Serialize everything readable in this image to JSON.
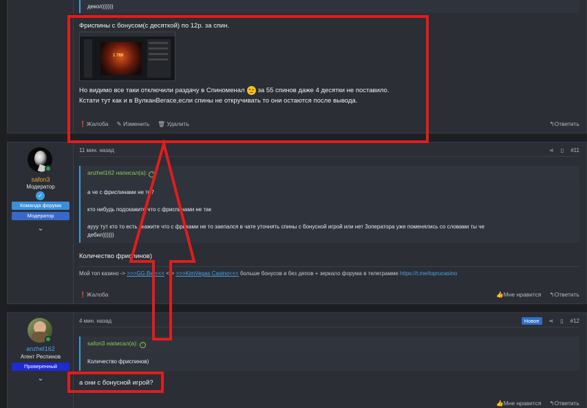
{
  "post10": {
    "top_quote_tail": "декол))))))",
    "line1": "Фриспины с бонусом(с десяткой) по 12р. за спин.",
    "line2_a": "Но видимо все таки отключили раздачу в Спиноменал",
    "line2_b": "за 55 спинов даже 4 десятки не поставило.",
    "line3": "Кстати тут как и в ВулканВегасе,если спины не откручивать то они остаются после вывода.",
    "report": "Жалоба",
    "edit": "Изменить",
    "delete": "Удалить",
    "reply": "Ответить",
    "thumb_title": "1 769"
  },
  "post11": {
    "username": "safon3",
    "user_title": "Модератор",
    "banner1": "Команда форума",
    "banner2": "Модератор",
    "date": "11 мин. назад",
    "number": "#11",
    "quote_author": "anzhel162 написал(а):",
    "quote_lines": [
      "а че с фриспинами не то?",
      "кто нибудь подскажите что с фриспинами не так",
      "аууу тут кто то есть скажите что с фрихами не то заепался в чате уточнять спины с бонусной игрой или нет 3опeратора уже поменялись со словами ты че",
      "дебил))))))"
    ],
    "text": "Количество фриспинов)",
    "sig_prefix": "Мой топ казино ->",
    "sig_link1": ">>>GG.Bet<<<",
    "sig_sep": "<->",
    "sig_link2": ">>>KimVegas Casino<<<",
    "sig_middle": "больше бонусов и без депов + зеркало форума в телеграмме",
    "sig_link3": "https://t.me/toprucasino",
    "report": "Жалоба",
    "like": "Мне нравится",
    "reply": "Ответить"
  },
  "post12": {
    "username": "anzhel162",
    "user_title": "Агент Респинов",
    "banner1": "Проверенный",
    "date": "4 мин. назад",
    "new_label": "Новое",
    "number": "#12",
    "quote_author": "safon3 написал(а):",
    "quote_line": "Количество фриспинов)",
    "text": "а они с бонусной игрой?",
    "like": "Мне нравится",
    "reply": "Ответить"
  },
  "colors": {
    "accent": "#3aa0e8",
    "highlight": "#e41c1c",
    "quote_author": "#8fcc54",
    "moderator_name": "#e8a33a",
    "member_name": "#4ca3e8"
  }
}
